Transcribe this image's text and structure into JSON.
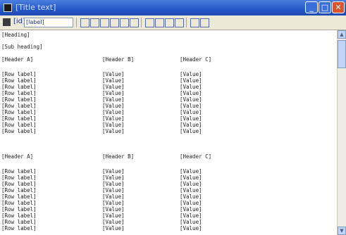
{
  "window": {
    "title": "[Title text]"
  },
  "toolbar": {
    "dropdown_label": "[label]",
    "prefix_label": "[id]"
  },
  "content": {
    "heading": "[Heading]",
    "subheading": "[Sub heading]",
    "section1": {
      "col1": "[Header A]",
      "col2": "[Header B]",
      "col3": "[Header C]",
      "rows": [
        [
          "[Row label]",
          "[Value]",
          "[Value]"
        ],
        [
          "[Row label]",
          "[Value]",
          "[Value]"
        ],
        [
          "[Row label]",
          "[Value]",
          "[Value]"
        ],
        [
          "[Row label]",
          "[Value]",
          "[Value]"
        ],
        [
          "[Row label]",
          "[Value]",
          "[Value]"
        ],
        [
          "[Row label]",
          "[Value]",
          "[Value]"
        ],
        [
          "[Row label]",
          "[Value]",
          "[Value]"
        ],
        [
          "[Row label]",
          "[Value]",
          "[Value]"
        ],
        [
          "[Row label]",
          "[Value]",
          "[Value]"
        ],
        [
          "[Row label]",
          "[Value]",
          "[Value]"
        ]
      ]
    },
    "section2": {
      "col1": "[Header A]",
      "col2": "[Header B]",
      "col3": "[Header C]",
      "rows": [
        [
          "[Row label]",
          "[Value]",
          "[Value]"
        ],
        [
          "[Row label]",
          "[Value]",
          "[Value]"
        ],
        [
          "[Row label]",
          "[Value]",
          "[Value]"
        ],
        [
          "[Row label]",
          "[Value]",
          "[Value]"
        ],
        [
          "[Row label]",
          "[Value]",
          "[Value]"
        ],
        [
          "[Row label]",
          "[Value]",
          "[Value]"
        ],
        [
          "[Row label]",
          "[Value]",
          "[Value]"
        ],
        [
          "[Row label]",
          "[Value]",
          "[Value]"
        ],
        [
          "[Row label]",
          "[Value]",
          "[Value]"
        ],
        [
          "[Row label]",
          "[Value]",
          "[Value]"
        ]
      ]
    }
  }
}
